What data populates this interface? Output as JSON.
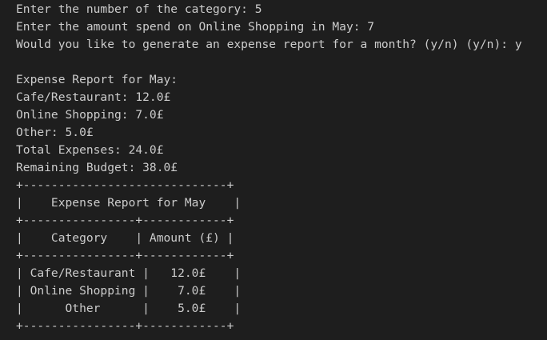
{
  "terminal": {
    "prompts": [
      "Enter the number of the category: 5",
      "Enter the amount spend on Online Shopping in May: 7",
      "Would you like to generate an expense report for a month? (y/n) (y/n): y"
    ],
    "blank": "",
    "report": {
      "heading": "Expense Report for May:",
      "lines": [
        "Cafe/Restaurant: 12.0£",
        "Online Shopping: 7.0£",
        "Other: 5.0£",
        "Total Expenses: 24.0£",
        "Remaining Budget: 38.0£"
      ]
    },
    "table": {
      "border_top": "+-----------------------------+",
      "title_row": "|    Expense Report for May    |",
      "border_mid": "+----------------+------------+",
      "header_row": "|    Category    | Amount (£) |",
      "border_header_bottom": "+----------------+------------+",
      "rows": [
        "| Cafe/Restaurant |   12.0£    |",
        "| Online Shopping |    7.0£    |",
        "|      Other      |    5.0£    |"
      ],
      "border_bottom": "+----------------+------------+"
    }
  },
  "colors": {
    "background": "#1e1e1e",
    "text": "#cccccc"
  }
}
